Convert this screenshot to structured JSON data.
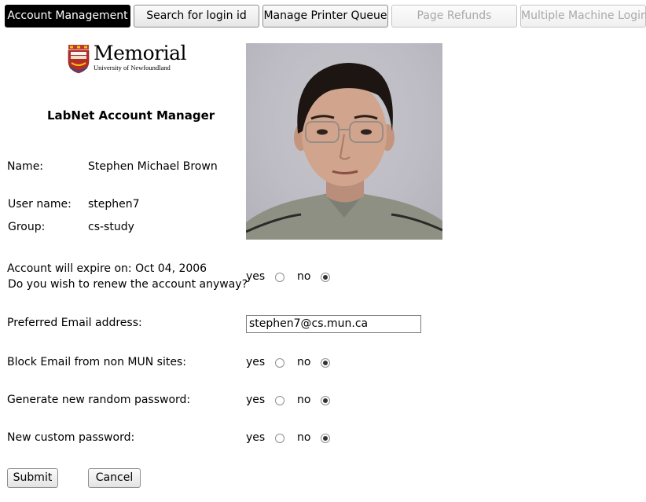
{
  "tabs": [
    {
      "label": "Account Management",
      "state": "active"
    },
    {
      "label": "Search for login id",
      "state": "normal"
    },
    {
      "label": "Manage Printer Queue",
      "state": "normal"
    },
    {
      "label": "Page Refunds",
      "state": "disabled"
    },
    {
      "label": "Multiple Machine Login",
      "state": "disabled"
    }
  ],
  "logo": {
    "name": "Memorial",
    "subtitle": "University of Newfoundland",
    "icon": "university-crest-icon"
  },
  "page_title": "LabNet Account Manager",
  "user": {
    "name_label": "Name:",
    "name_value": "Stephen Michael Brown",
    "username_label": "User name:",
    "username_value": "stephen7",
    "group_label": "Group:",
    "group_value": "cs-study"
  },
  "expire": {
    "line1": "Account will expire on: Oct 04, 2006",
    "line2": "Do you wish to renew the account anyway?"
  },
  "email": {
    "label": "Preferred Email address:",
    "value": "stephen7@cs.mun.ca"
  },
  "block_email": {
    "label": "Block Email from non MUN sites:"
  },
  "random_password": {
    "label": "Generate new random password:"
  },
  "custom_password": {
    "label": "New custom password:"
  },
  "radio_labels": {
    "yes": "yes",
    "no": "no"
  },
  "selected": {
    "renew": "no",
    "block_email": "no",
    "random_password": "no",
    "custom_password": "no"
  },
  "buttons": {
    "submit": "Submit",
    "cancel": "Cancel"
  }
}
